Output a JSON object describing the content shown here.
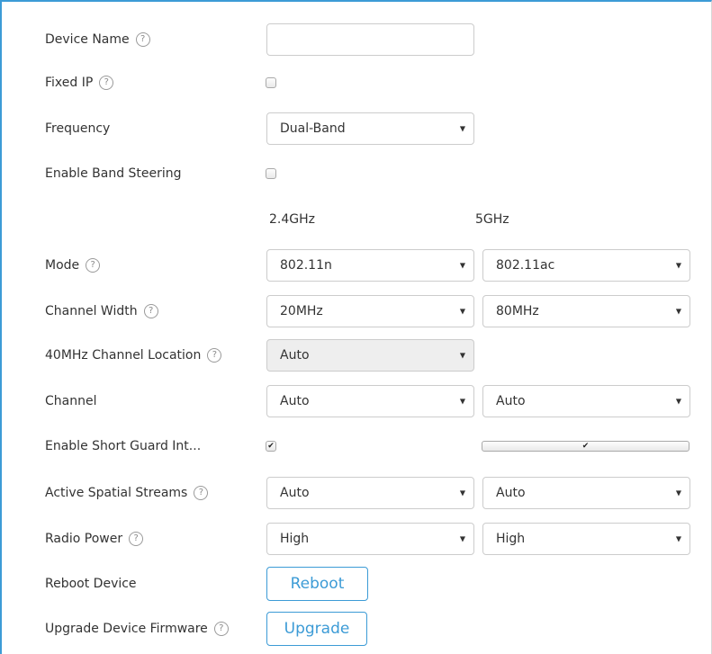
{
  "fields": {
    "device_name": {
      "label": "Device Name",
      "help": "?",
      "value": ""
    },
    "fixed_ip": {
      "label": "Fixed IP",
      "help": "?",
      "checked": false
    },
    "frequency": {
      "label": "Frequency",
      "value": "Dual-Band"
    },
    "band_steering": {
      "label": "Enable Band Steering",
      "checked": false
    },
    "bands": {
      "band1": "2.4GHz",
      "band2": "5GHz"
    },
    "mode": {
      "label": "Mode",
      "help": "?",
      "value_24": "802.11n",
      "value_5": "802.11ac"
    },
    "channel_width": {
      "label": "Channel Width",
      "help": "?",
      "value_24": "20MHz",
      "value_5": "80MHz"
    },
    "channel_location": {
      "label": "40MHz Channel Location",
      "help": "?",
      "value": "Auto"
    },
    "channel": {
      "label": "Channel",
      "value_24": "Auto",
      "value_5": "Auto"
    },
    "short_guard": {
      "label": "Enable Short Guard Int...",
      "checked_24": true,
      "checked_5": true
    },
    "spatial_streams": {
      "label": "Active Spatial Streams",
      "help": "?",
      "value_24": "Auto",
      "value_5": "Auto"
    },
    "radio_power": {
      "label": "Radio Power",
      "help": "?",
      "value_24": "High",
      "value_5": "High"
    },
    "reboot": {
      "label": "Reboot Device",
      "button": "Reboot"
    },
    "upgrade": {
      "label": "Upgrade Device Firmware",
      "help": "?",
      "button": "Upgrade"
    }
  },
  "glyphs": {
    "caret": "▼",
    "check": "✔"
  },
  "colors": {
    "accent": "#3c9bd6",
    "border": "#cccccc",
    "disabled_bg": "#eeeeee"
  }
}
